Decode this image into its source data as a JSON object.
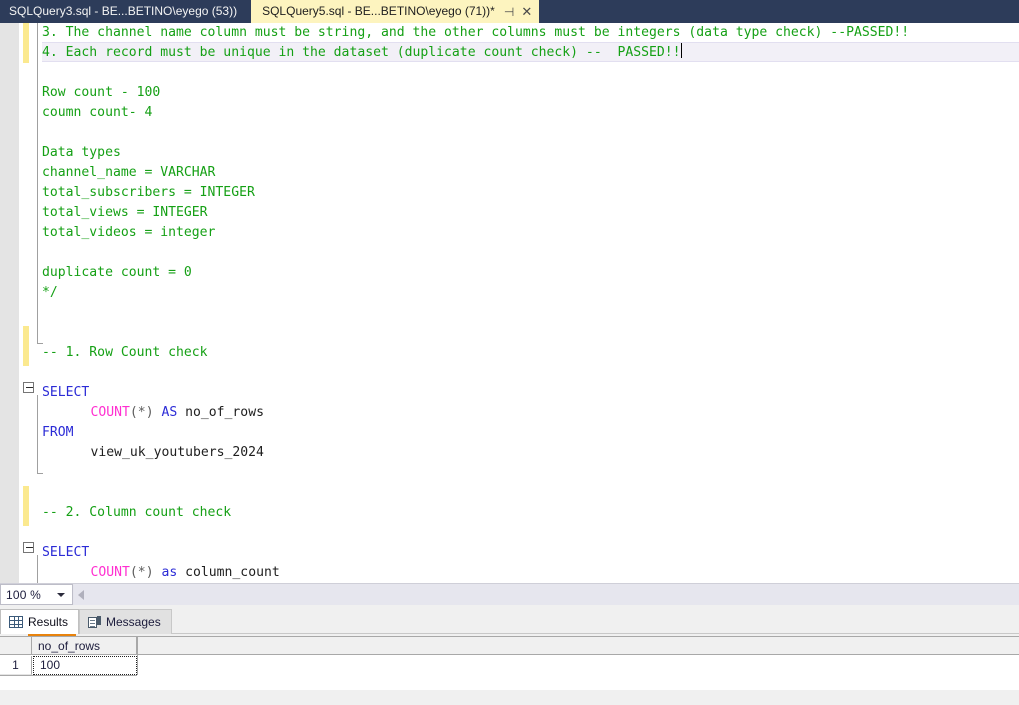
{
  "window": {
    "app": "SQL Server Management Studio",
    "tabbar_color": "#2d3c5a",
    "active_tab_color": "#fdf4bf"
  },
  "tabs": [
    {
      "name": "tab-sqlquery3",
      "title": "SQLQuery3.sql - BE...BETINO\\eyego (53))",
      "active": false,
      "dirty": false
    },
    {
      "name": "tab-sqlquery5",
      "title": "SQLQuery5.sql - BE...BETINO\\eyego (71))*",
      "active": true,
      "dirty": true,
      "pin_icon": "pin-icon",
      "close_icon": "close-icon",
      "pin_glyph": "⊣",
      "close_glyph": "✕"
    }
  ],
  "editor": {
    "lines": [
      {
        "n": 1,
        "indent": 0,
        "text": "3. The channel name column must be string, and the other columns must be integers (data type check) --PASSED!!",
        "type": "comment"
      },
      {
        "n": 2,
        "indent": 0,
        "text": "4. Each record must be unique in the dataset (duplicate count check) --  PASSED!!",
        "type": "comment",
        "current": true,
        "caret": true
      },
      {
        "n": 3,
        "indent": 0,
        "text": "",
        "type": "blank"
      },
      {
        "n": 4,
        "indent": 0,
        "text": "Row count - 100",
        "type": "comment"
      },
      {
        "n": 5,
        "indent": 0,
        "text": "coumn count- 4",
        "type": "comment"
      },
      {
        "n": 6,
        "indent": 0,
        "text": "",
        "type": "blank"
      },
      {
        "n": 7,
        "indent": 0,
        "text": "Data types",
        "type": "comment"
      },
      {
        "n": 8,
        "indent": 0,
        "text": "channel_name = VARCHAR",
        "type": "comment"
      },
      {
        "n": 9,
        "indent": 0,
        "text": "total_subscribers = INTEGER",
        "type": "comment"
      },
      {
        "n": 10,
        "indent": 0,
        "text": "total_views = INTEGER",
        "type": "comment"
      },
      {
        "n": 11,
        "indent": 0,
        "text": "total_videos = integer",
        "type": "comment"
      },
      {
        "n": 12,
        "indent": 0,
        "text": "",
        "type": "blank"
      },
      {
        "n": 13,
        "indent": 0,
        "text": "duplicate count = 0",
        "type": "comment"
      },
      {
        "n": 14,
        "indent": 0,
        "text": "*/",
        "type": "comment"
      },
      {
        "n": 15,
        "indent": 0,
        "text": "",
        "type": "blank"
      },
      {
        "n": 16,
        "indent": 0,
        "text": "",
        "type": "blank"
      },
      {
        "n": 17,
        "indent": 0,
        "text": "-- 1. Row Count check",
        "type": "comment"
      },
      {
        "n": 18,
        "indent": 0,
        "text": "",
        "type": "blank"
      },
      {
        "n": 19,
        "indent": 0,
        "text": "SELECT",
        "type": "keyword"
      },
      {
        "n": 20,
        "indent": 6,
        "text": "COUNT(*) AS no_of_rows",
        "type": "mixed"
      },
      {
        "n": 21,
        "indent": 0,
        "text": "FROM",
        "type": "keyword"
      },
      {
        "n": 22,
        "indent": 6,
        "text": "view_uk_youtubers_2024",
        "type": "identifier"
      },
      {
        "n": 23,
        "indent": 0,
        "text": "",
        "type": "blank"
      },
      {
        "n": 24,
        "indent": 0,
        "text": "",
        "type": "blank"
      },
      {
        "n": 25,
        "indent": 0,
        "text": "-- 2. Column count check",
        "type": "comment"
      },
      {
        "n": 26,
        "indent": 0,
        "text": "",
        "type": "blank"
      },
      {
        "n": 27,
        "indent": 0,
        "text": "SELECT",
        "type": "keyword"
      },
      {
        "n": 28,
        "indent": 6,
        "text": "COUNT(*) as column_count",
        "type": "mixed",
        "clipped": true
      }
    ],
    "colors": {
      "comment": "#15a015",
      "keyword": "#2b2bd6",
      "function": "#ff2fd0",
      "identifier": "#1e1e1e",
      "punctuation": "#5c5c5c",
      "change_bar": "#fbe98f",
      "current_line": "#f2f0f7",
      "selection_margin": "#e4e4e4"
    }
  },
  "zoom_strip": {
    "zoom_value": "100 %",
    "dropdown_icon": "chevron-down-icon",
    "scroll_left_icon": "scroll-left-arrow-icon"
  },
  "results_pane": {
    "tabs": [
      {
        "name": "tab-results",
        "label": "Results",
        "icon": "grid-icon",
        "active": true
      },
      {
        "name": "tab-messages",
        "label": "Messages",
        "icon": "message-icon",
        "active": false
      }
    ],
    "active_underline_color": "#e8820c",
    "grid": {
      "columns": [
        "no_of_rows"
      ],
      "rows": [
        {
          "rownum": "1",
          "cells": [
            "100"
          ],
          "selected_cell": 0
        }
      ]
    }
  }
}
